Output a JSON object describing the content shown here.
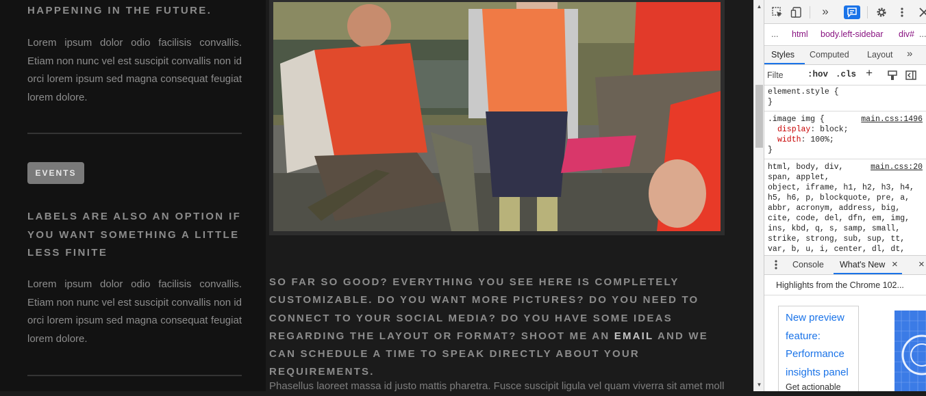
{
  "page": {
    "intro_heading": "HAPPENING IN THE FUTURE.",
    "intro_text": "Lorem ipsum dolor odio facilisis convallis. Etiam non nunc vel est suscipit convallis non id orci lorem ipsum sed magna consequat feugiat lorem dolore.",
    "events_label": "EVENTS",
    "labels_heading": "LABELS ARE ALSO AN OPTION IF YOU WANT SOMETHING A LITTLE LESS FINITE",
    "labels_text": "Lorem ipsum dolor odio facilisis convallis. Etiam non nunc vel est suscipit convallis non id orci lorem ipsum sed magna consequat feugiat lorem dolore.",
    "main_heading_before": "SO FAR SO GOOD? EVERYTHING YOU SEE HERE IS COMPLETELY CUSTOMIZABLE. DO YOU WANT MORE PICTURES? DO YOU NEED TO CONNECT TO YOUR SOCIAL MEDIA? DO YOU HAVE SOME IDEAS REGARDING THE LAYOUT OR FORMAT? SHOOT ME AN ",
    "main_heading_link": "EMAIL",
    "main_heading_after": " AND WE CAN SCHEDULE A TIME TO SPEAK DIRECTLY ABOUT YOUR REQUIREMENTS.",
    "main_paragraph": "Phasellus laoreet massa id justo mattis pharetra. Fusce suscipit ligula vel quam viverra sit amet mollis"
  },
  "devtools": {
    "toolbar": {
      "overflow_symbol": "»"
    },
    "breadcrumb": {
      "leading_dots": "...",
      "items": [
        "html",
        "body.left-sidebar",
        "div#"
      ],
      "trailing_dots": "..."
    },
    "subtabs": [
      "Styles",
      "Computed",
      "Layout"
    ],
    "subtabs_overflow": "»",
    "filter": {
      "placeholder": "Filte",
      "hov": ":hov",
      "cls": ".cls",
      "add": "+"
    },
    "rules": {
      "element_style": "element.style {",
      "element_close": "}",
      "image_selector": ".image img {",
      "image_source": "main.css:1496",
      "image_props": [
        {
          "name": "display",
          "value": "block;"
        },
        {
          "name": "width",
          "value": "100%;"
        }
      ],
      "image_close": "}",
      "reset_source": "main.css:20",
      "reset_lines": [
        "html, body, div,",
        "span, applet,",
        "object, iframe, h1, h2, h3, h4,",
        "h5, h6, p, blockquote, pre, a,",
        "abbr, acronym, address, big,",
        "cite, code, del, dfn, em, img,",
        "ins, kbd, q, s, samp, small,",
        "strike, strong, sub, sup, tt,",
        "var, b, u, i, center, dl, dt,"
      ]
    },
    "drawer": {
      "tabs": [
        "Console",
        "What's New"
      ],
      "close_symbol": "×",
      "highlights": "Highlights from the Chrome 102...",
      "card_title": "New preview feature: Performance insights panel",
      "card_subtitle": "Get actionable"
    },
    "colors": {
      "accent": "#1a73e8",
      "selector_prop": "#c80000",
      "breadcrumb": "#881280"
    }
  }
}
